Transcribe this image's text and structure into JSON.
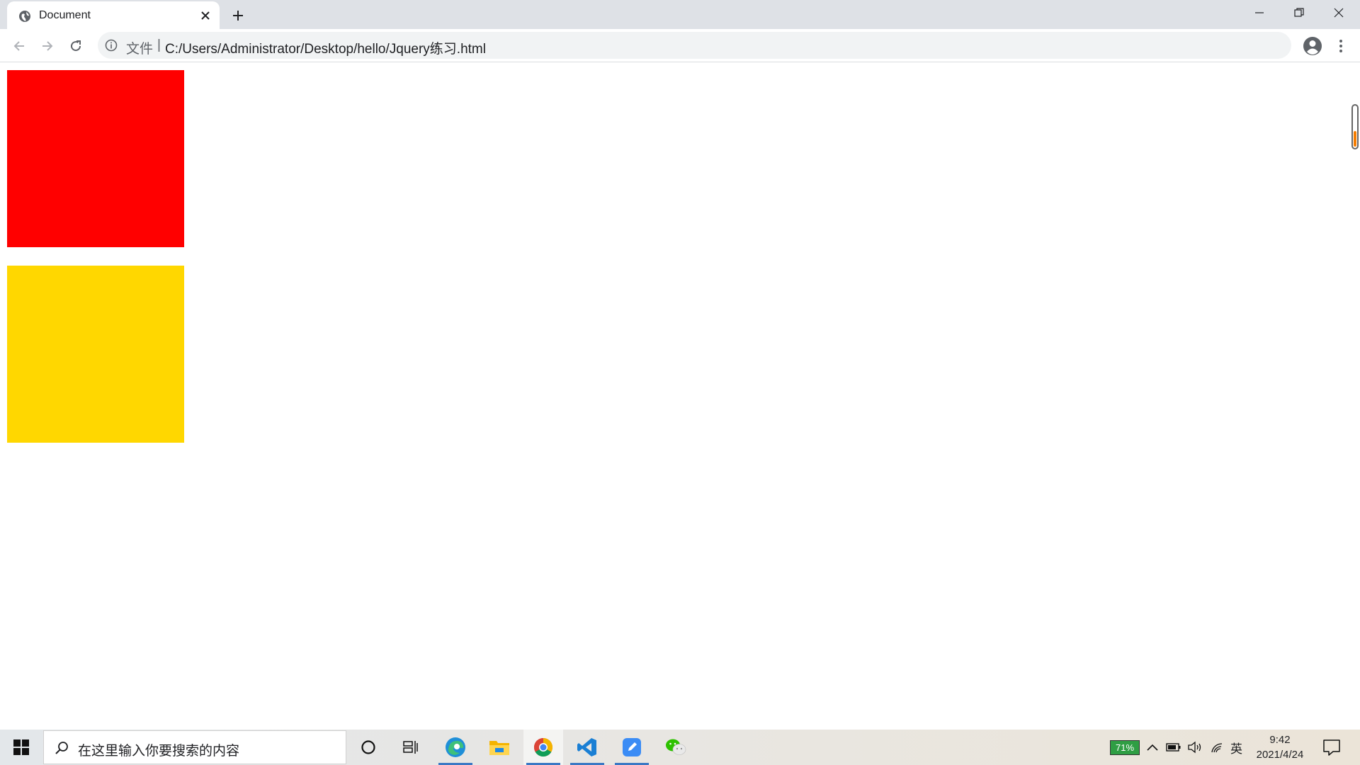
{
  "browser": {
    "tab": {
      "title": "Document",
      "favicon": "globe-icon"
    },
    "toolbar": {
      "scheme_label": "文件",
      "separator": "|",
      "url": "C:/Users/Administrator/Desktop/hello/Jquery练习.html"
    }
  },
  "page": {
    "boxes": [
      {
        "name": "red-box",
        "color": "#ff0000"
      },
      {
        "name": "yellow-box",
        "color": "#ffd700"
      }
    ]
  },
  "taskbar": {
    "search_placeholder": "在这里输入你要搜索的内容",
    "pinned_apps": [
      "cortana-icon",
      "task-view-icon",
      "edge-icon",
      "file-explorer-icon",
      "chrome-icon",
      "vscode-icon",
      "note-app-icon",
      "wechat-icon"
    ],
    "tray": {
      "battery_percent": "71%",
      "ime": "英",
      "time": "9:42",
      "date": "2021/4/24"
    }
  }
}
